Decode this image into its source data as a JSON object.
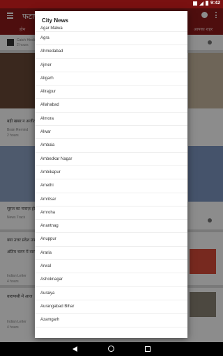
{
  "status_bar": {
    "time": "9:42"
  },
  "app_bar": {
    "title": "फटाफ"
  },
  "tabs": [
    "होम",
    "",
    "",
    "",
    "",
    "आपका शहर"
  ],
  "feed": {
    "items": [
      {
        "title": "",
        "source": "Catch Hindi",
        "time": "2 hours"
      },
      {
        "title": "बड़ी खबर न अजीत",
        "source": "Brain Remind",
        "time": "2 hours"
      },
      {
        "title": "सूरज का नाराज़ हो",
        "source": "News Track",
        "time": "3 hours"
      },
      {
        "title": "क्या उत्तर प्रदेश उपच",
        "source": "",
        "time": ""
      },
      {
        "title": "अंतिम चरण में वाराण",
        "source": "Indian Letter",
        "time": "4 hours"
      },
      {
        "title": "वाराणसी में आज",
        "source": "Indian Letter",
        "time": "4 hours"
      }
    ]
  },
  "dialog": {
    "title": "City News",
    "cities": [
      "Agar Malwa",
      "Agra",
      "Ahmedabad",
      "Ajmer",
      "Aligarh",
      "Alirajpur",
      "Allahabad",
      "Almora",
      "Alwar",
      "Ambala",
      "Ambedkar Nagar",
      "Ambikapur",
      "Amethi",
      "Amritsar",
      "Amroha",
      "Anantnag",
      "Anuppur",
      "Araria",
      "Arwal",
      "Ashoknagar",
      "Auraiya",
      "Aurangabad Bihar",
      "Azamgarh"
    ]
  },
  "icons": {
    "menu": "menu-icon",
    "compass": "compass-icon",
    "more": "more-vert-icon",
    "back": "nav-back-icon",
    "home": "nav-home-icon",
    "recent": "nav-recent-icon",
    "share": "share-icon"
  },
  "colors": {
    "app_bar": "#8f1b1b",
    "status_bar": "#7a1111"
  }
}
